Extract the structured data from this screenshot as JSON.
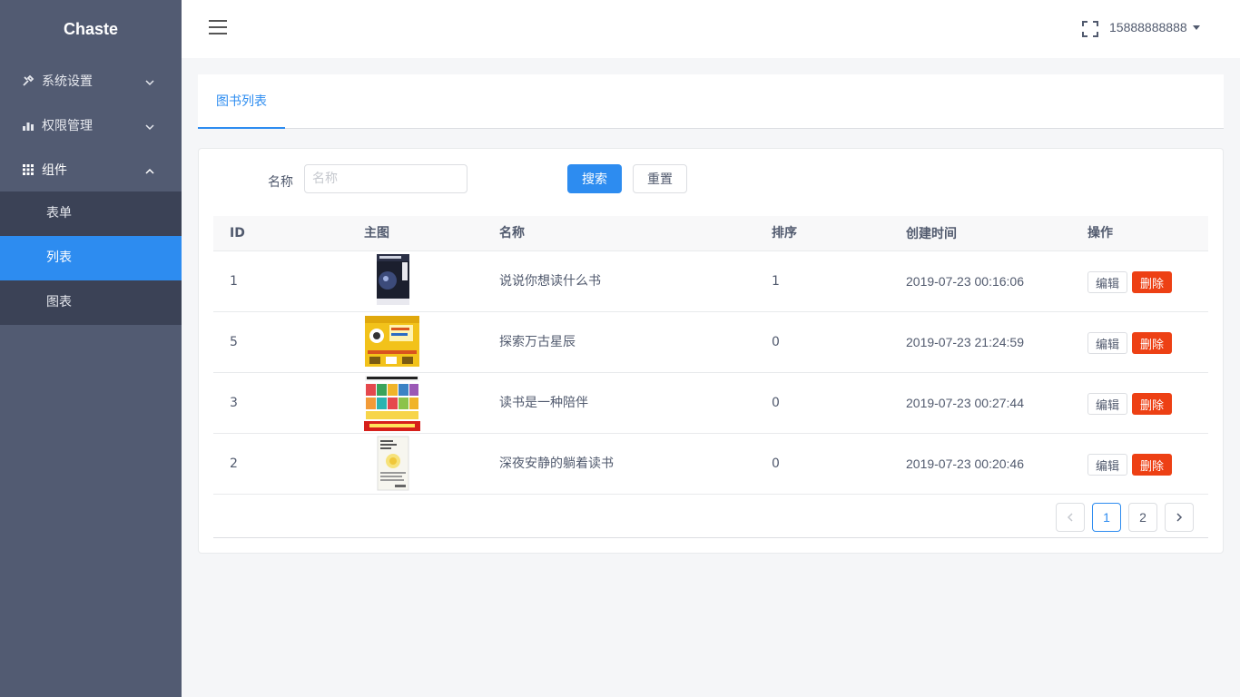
{
  "sidebar": {
    "brand": "Chaste",
    "groups": [
      {
        "label": "系统设置",
        "icon": "wrench-icon",
        "expanded": false
      },
      {
        "label": "权限管理",
        "icon": "chart-bars-icon",
        "expanded": false
      },
      {
        "label": "组件",
        "icon": "grid-icon",
        "expanded": true
      }
    ],
    "sub_items": [
      {
        "label": "表单",
        "active": false
      },
      {
        "label": "列表",
        "active": true
      },
      {
        "label": "图表",
        "active": false
      }
    ]
  },
  "header": {
    "menu_icon": "hamburger-icon",
    "fullscreen_icon": "fullscreen-icon",
    "username": "15888888888"
  },
  "tabs": [
    {
      "label": "图书列表",
      "active": true
    }
  ],
  "search": {
    "label": "名称",
    "placeholder": "名称",
    "value": "",
    "search_button": "搜索",
    "reset_button": "重置"
  },
  "table": {
    "columns": [
      "ID",
      "主图",
      "名称",
      "排序",
      "创建时间",
      "操作"
    ],
    "rows": [
      {
        "id": "1",
        "name": "说说你想读什么书",
        "sort": "1",
        "created": "2019-07-23 00:16:06",
        "cover": "astronomy-book-cover"
      },
      {
        "id": "5",
        "name": "探索万古星辰",
        "sort": "0",
        "created": "2019-07-23 21:24:59",
        "cover": "yellow-book-box-cover"
      },
      {
        "id": "3",
        "name": "读书是一种陪伴",
        "sort": "0",
        "created": "2019-07-23 00:27:44",
        "cover": "kids-collection-cover"
      },
      {
        "id": "2",
        "name": "深夜安静的躺着读书",
        "sort": "0",
        "created": "2019-07-23 00:20:46",
        "cover": "white-book-cover"
      }
    ],
    "edit_label": "编辑",
    "delete_label": "删除"
  },
  "pagination": {
    "pages": [
      "1",
      "2"
    ],
    "current": "1",
    "prev_icon": "chevron-left-icon",
    "next_icon": "chevron-right-icon"
  },
  "colors": {
    "sidebar_bg": "#525b72",
    "submenu_bg": "#3b4256",
    "primary": "#2d8cf0",
    "danger": "#ed4014"
  }
}
